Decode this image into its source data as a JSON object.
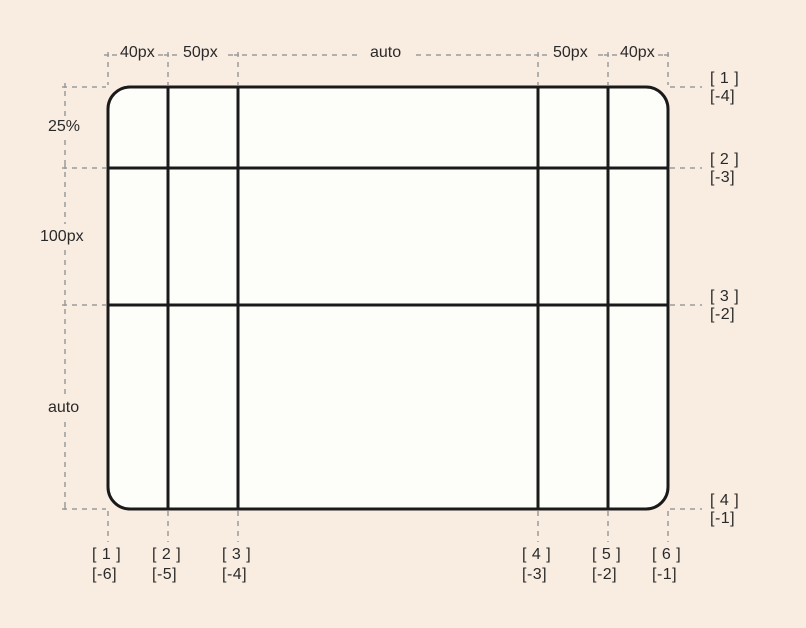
{
  "colSizes": [
    "40px",
    "50px",
    "auto",
    "50px",
    "40px"
  ],
  "rowSizes": [
    "25%",
    "100px",
    "auto"
  ],
  "colIndices": {
    "pos": [
      "[ 1 ]",
      "[ 2 ]",
      "[ 3 ]",
      "[ 4 ]",
      "[ 5 ]",
      "[ 6 ]"
    ],
    "neg": [
      "[-6]",
      "[-5]",
      "[-4]",
      "[-3]",
      "[-2]",
      "[-1]"
    ]
  },
  "rowIndices": {
    "pos": [
      "[ 1 ]",
      "[ 2 ]",
      "[ 3 ]",
      "[ 4 ]"
    ],
    "neg": [
      "[-4]",
      "[-3]",
      "[-2]",
      "[-1]"
    ]
  },
  "chart_data": {
    "type": "table",
    "title": "CSS Grid track sizes and line indices diagram",
    "columns": [
      {
        "size": "40px"
      },
      {
        "size": "50px"
      },
      {
        "size": "auto"
      },
      {
        "size": "50px"
      },
      {
        "size": "40px"
      }
    ],
    "rows": [
      {
        "size": "25%"
      },
      {
        "size": "100px"
      },
      {
        "size": "auto"
      }
    ],
    "column_lines": [
      {
        "positive": 1,
        "negative": -6
      },
      {
        "positive": 2,
        "negative": -5
      },
      {
        "positive": 3,
        "negative": -4
      },
      {
        "positive": 4,
        "negative": -3
      },
      {
        "positive": 5,
        "negative": -2
      },
      {
        "positive": 6,
        "negative": -1
      }
    ],
    "row_lines": [
      {
        "positive": 1,
        "negative": -4
      },
      {
        "positive": 2,
        "negative": -3
      },
      {
        "positive": 3,
        "negative": -2
      },
      {
        "positive": 4,
        "negative": -1
      }
    ]
  }
}
